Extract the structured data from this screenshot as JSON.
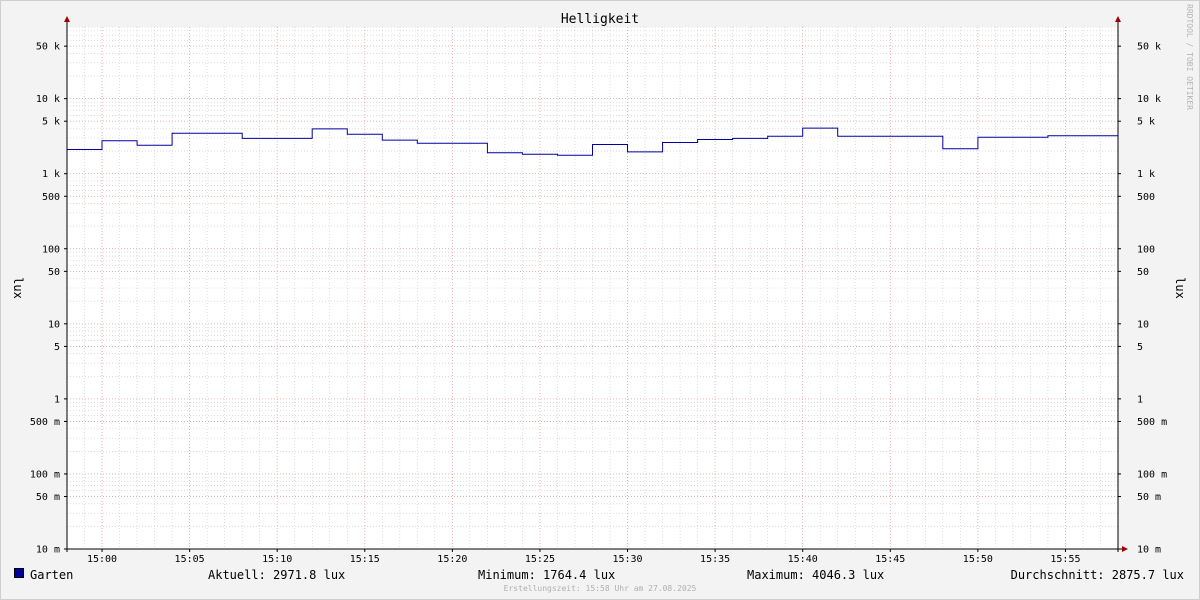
{
  "chart_data": {
    "type": "line",
    "title": "Helligkeit",
    "ylabel": "lux",
    "y_scale": "log",
    "ylim": [
      0.01,
      90000
    ],
    "x_range": [
      "14:58",
      "15:58"
    ],
    "x_ticks": [
      "15:00",
      "15:05",
      "15:10",
      "15:15",
      "15:20",
      "15:25",
      "15:30",
      "15:35",
      "15:40",
      "15:45",
      "15:50",
      "15:55"
    ],
    "y_ticks": [
      {
        "value": 0.01,
        "label": "10 m"
      },
      {
        "value": 0.05,
        "label": "50 m"
      },
      {
        "value": 0.1,
        "label": "100 m"
      },
      {
        "value": 0.5,
        "label": "500 m"
      },
      {
        "value": 1,
        "label": "1"
      },
      {
        "value": 5,
        "label": "5"
      },
      {
        "value": 10,
        "label": "10"
      },
      {
        "value": 50,
        "label": "50"
      },
      {
        "value": 100,
        "label": "100"
      },
      {
        "value": 500,
        "label": "500"
      },
      {
        "value": 1000,
        "label": "1 k"
      },
      {
        "value": 5000,
        "label": "5 k"
      },
      {
        "value": 10000,
        "label": "10 k"
      },
      {
        "value": 50000,
        "label": "50 k"
      }
    ],
    "grid": true,
    "step": true,
    "series": [
      {
        "name": "Garten",
        "color": "#0000a0",
        "x": [
          "14:58",
          "15:00",
          "15:02",
          "15:04",
          "15:08",
          "15:12",
          "15:14",
          "15:16",
          "15:18",
          "15:22",
          "15:24",
          "15:26",
          "15:28",
          "15:30",
          "15:32",
          "15:34",
          "15:36",
          "15:38",
          "15:40",
          "15:42",
          "15:46",
          "15:48",
          "15:50",
          "15:54",
          "15:58"
        ],
        "values": [
          2100,
          2750,
          2400,
          3450,
          2950,
          3950,
          3350,
          2800,
          2550,
          1900,
          1820,
          1764.4,
          2450,
          1950,
          2600,
          2850,
          2950,
          3150,
          4046.3,
          3150,
          3150,
          2150,
          3050,
          3200,
          2971.8
        ]
      }
    ]
  },
  "legend": {
    "series_name": "Garten",
    "aktuell": "Aktuell: 2971.8 lux",
    "minimum": "Minimum: 1764.4 lux",
    "maximum": "Maximum: 4046.3 lux",
    "durchschnitt": "Durchschnitt: 2875.7 lux"
  },
  "watermark": "RRDTOOL / TOBI OETIKER",
  "footer": "Erstellungszeit: 15:58 Uhr am 27.08.2025",
  "colors": {
    "series": "#0000a0",
    "major_grid": "#e8a0a0",
    "minor_grid": "#c8c8c8",
    "arrow": "#a00000"
  }
}
